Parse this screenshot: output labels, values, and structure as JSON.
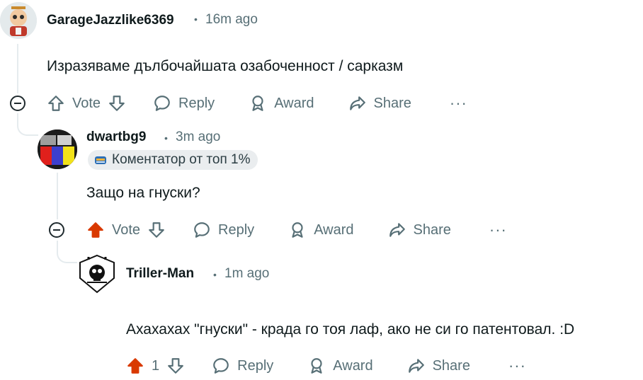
{
  "comments": [
    {
      "username": "GarageJazzlike6369",
      "time": "16m ago",
      "text": "Изразяваме дълбочайшата озабоченност / сарказм",
      "vote": "Vote",
      "reply": "Reply",
      "award": "Award",
      "share": "Share",
      "more": "···"
    },
    {
      "username": "dwartbg9",
      "time": "3m ago",
      "flair": "Коментатор от топ 1%",
      "text": "Защо на гнуски?",
      "vote": "Vote",
      "reply": "Reply",
      "award": "Award",
      "share": "Share",
      "more": "···"
    },
    {
      "username": "Triller-Man",
      "time": "1m ago",
      "text": "Ахахахах \"гнуски\" - крада го тоя лаф, ако не си го патентовал. :D",
      "vote": "1",
      "reply": "Reply",
      "award": "Award",
      "share": "Share",
      "more": "···"
    }
  ],
  "separator": "•",
  "colors": {
    "upvoted": "#d93900",
    "muted": "#576f76",
    "text": "#0f1a1c",
    "thread": "#e5ebee"
  }
}
